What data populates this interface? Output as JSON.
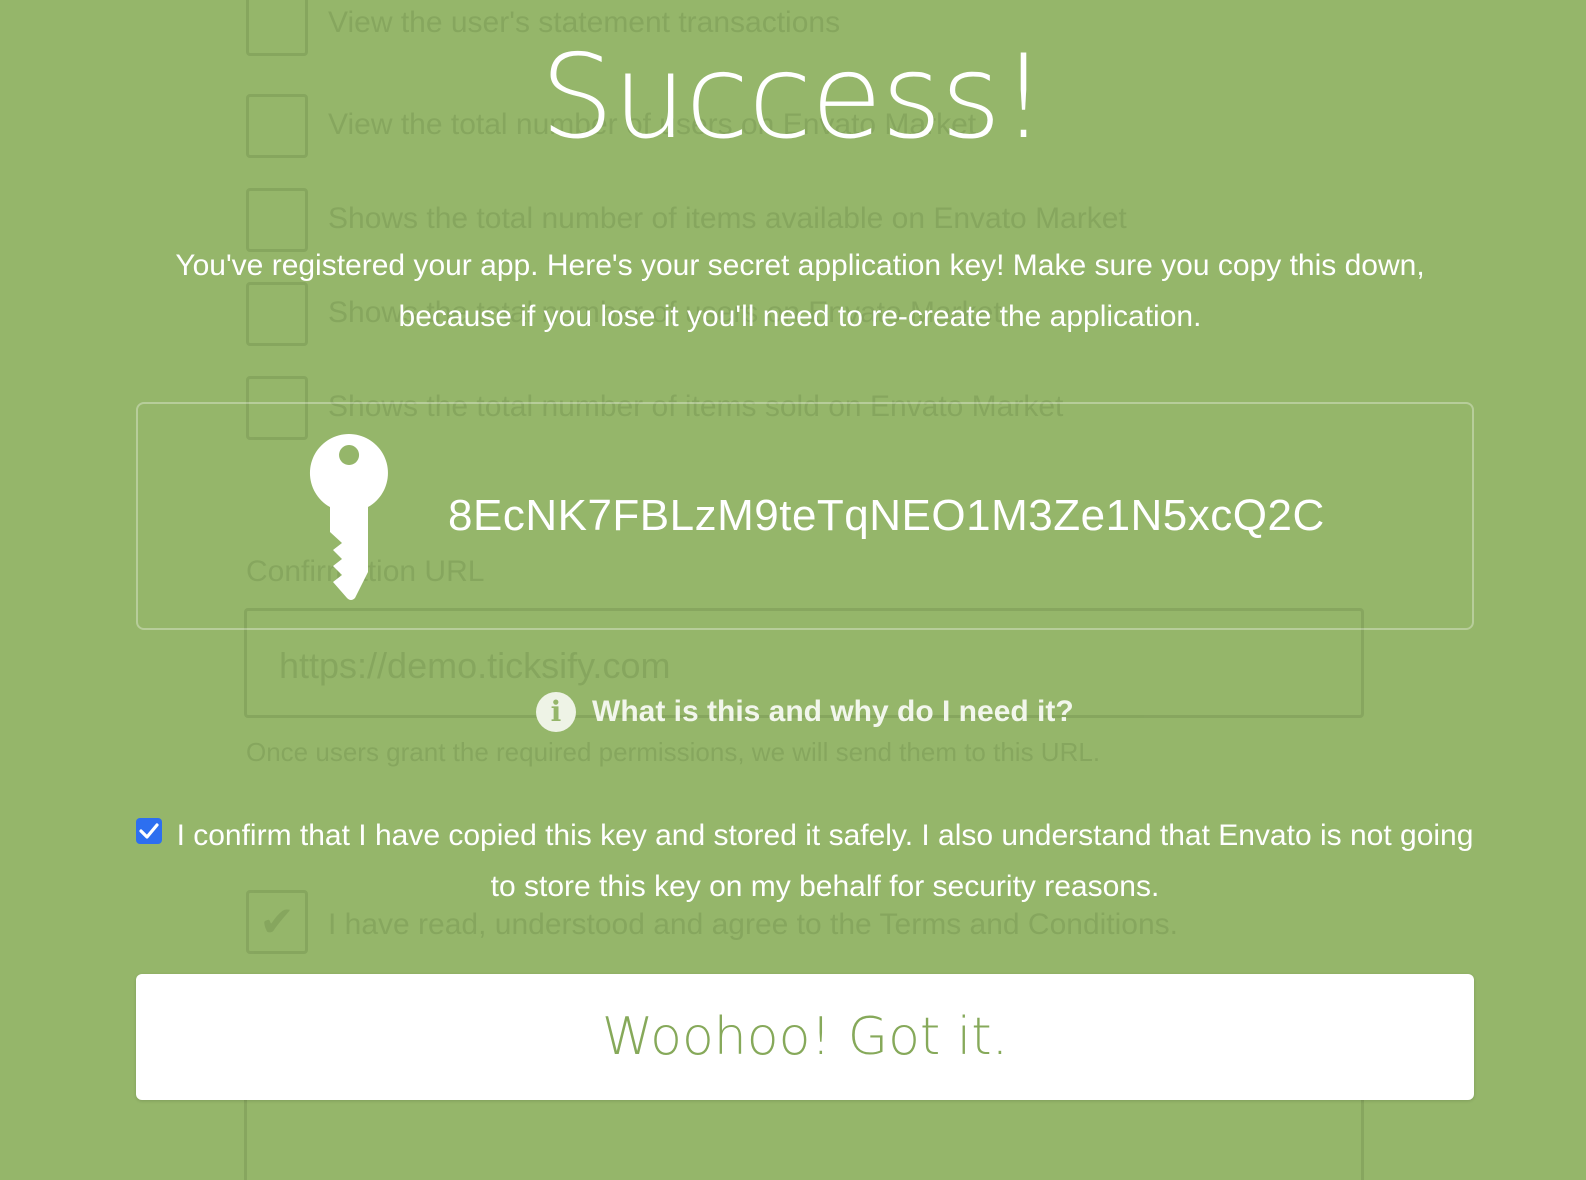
{
  "background_form": {
    "permissions": [
      "View the user's statement transactions",
      "View the total number of users on Envato Market",
      "Shows the total number of items available on Envato Market",
      "Shows the total number of users on Envato Market",
      "Shows the total number of items sold on Envato Market"
    ],
    "confirmation_url_label": "Confirmation URL",
    "confirmation_url_value": "https://demo.ticksify.com",
    "confirmation_url_help": "Once users grant the required permissions, we will send them to this URL.",
    "terms_text": "I have read, understood and agree to the Terms and Conditions."
  },
  "modal": {
    "title": "Success!",
    "intro": "You've registered your app. Here's your secret application key! Make sure you copy this down, because if you lose it you'll need to re-create the application.",
    "key_icon": "key-icon",
    "app_key": "8EcNK7FBLzM9teTqNEO1M3Ze1N5xcQ2C",
    "info_icon": "info-circle-icon",
    "info_link_text": "What is this and why do I need it?",
    "confirm_checked": true,
    "confirm_text": "I confirm that I have copied this key and stored it safely. I also understand that Envato is not going to store this key on my behalf for security reasons.",
    "button_label": "Woohoo! Got it."
  },
  "colors": {
    "background": "#95b66a",
    "button_text": "#86a95a",
    "checkbox": "#2d6ff0"
  }
}
